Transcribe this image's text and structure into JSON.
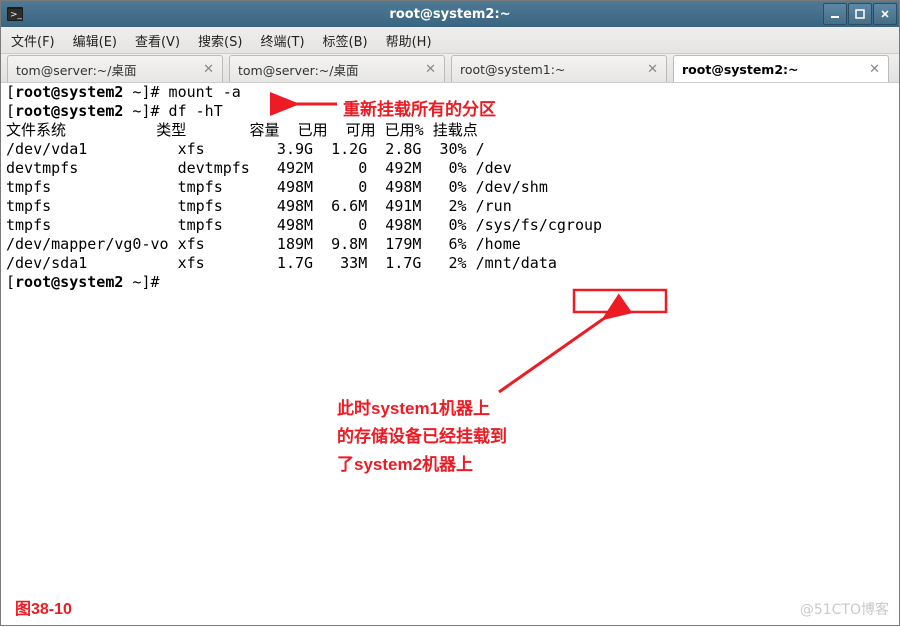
{
  "window": {
    "title": "root@system2:~"
  },
  "menubar": [
    "文件(F)",
    "编辑(E)",
    "查看(V)",
    "搜索(S)",
    "终端(T)",
    "标签(B)",
    "帮助(H)"
  ],
  "tabs": [
    {
      "label": "tom@server:~/桌面",
      "active": false
    },
    {
      "label": "tom@server:~/桌面",
      "active": false
    },
    {
      "label": "root@system1:~",
      "active": false
    },
    {
      "label": "root@system2:~",
      "active": true
    }
  ],
  "terminal": {
    "prompt_user": "root",
    "prompt_host": "system2",
    "prompt_cwd": "~",
    "prompt_suffix": "]#",
    "commands": {
      "mount": "mount -a",
      "df": "df -hT"
    },
    "df_header": "文件系统          类型       容量  已用  可用 已用% 挂载点",
    "df_rows": [
      {
        "fs": "/dev/vda1",
        "type": "xfs",
        "size": "3.9G",
        "used": "1.2G",
        "avail": "2.8G",
        "pct": "30%",
        "mount": "/"
      },
      {
        "fs": "devtmpfs",
        "type": "devtmpfs",
        "size": "492M",
        "used": "0",
        "avail": "492M",
        "pct": "0%",
        "mount": "/dev"
      },
      {
        "fs": "tmpfs",
        "type": "tmpfs",
        "size": "498M",
        "used": "0",
        "avail": "498M",
        "pct": "0%",
        "mount": "/dev/shm"
      },
      {
        "fs": "tmpfs",
        "type": "tmpfs",
        "size": "498M",
        "used": "6.6M",
        "avail": "491M",
        "pct": "2%",
        "mount": "/run"
      },
      {
        "fs": "tmpfs",
        "type": "tmpfs",
        "size": "498M",
        "used": "0",
        "avail": "498M",
        "pct": "0%",
        "mount": "/sys/fs/cgroup"
      },
      {
        "fs": "/dev/mapper/vg0-vo",
        "type": "xfs",
        "size": "189M",
        "used": "9.8M",
        "avail": "179M",
        "pct": "6%",
        "mount": "/home"
      },
      {
        "fs": "/dev/sda1",
        "type": "xfs",
        "size": "1.7G",
        "used": "33M",
        "avail": "1.7G",
        "pct": "2%",
        "mount": "/mnt/data"
      }
    ]
  },
  "annotations": {
    "arrow1_text": "重新挂载所有的分区",
    "arrow2_text": "此时system1机器上的存储设备已经挂载到了system2机器上",
    "arrow2_line1": "此时system1机器上",
    "arrow2_line2": "的存储设备已经挂载到",
    "arrow2_line3": "了system2机器上"
  },
  "footer": {
    "figure": "图38-10",
    "watermark": "@51CTO博客"
  }
}
